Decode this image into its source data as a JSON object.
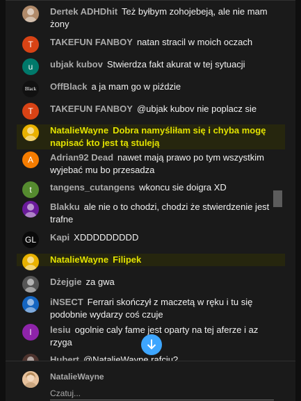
{
  "messages": [
    {
      "author": "Dertek ADHDhit",
      "text": "Też byłbym zohojebeją, ale nie mam żony",
      "avatar": {
        "letter": "",
        "color": "#b08a6a",
        "icon": "photo-avatar"
      }
    },
    {
      "author": "TAKEFUN FANBOY",
      "text": "natan stracil w moich oczach",
      "avatar": {
        "letter": "T",
        "color": "#d84315"
      }
    },
    {
      "author": "ubjak kubov",
      "text": "Stwierdza fakt akurat w tej sytuacji",
      "avatar": {
        "letter": "u",
        "color": "#00796b"
      }
    },
    {
      "author": "OffBlack",
      "text": "a ja mam go w piździe",
      "avatar": {
        "letter": "Black",
        "color": "#111111",
        "icon": "logo-avatar"
      }
    },
    {
      "author": "TAKEFUN FANBOY",
      "text": "@ubjak kubov nie poplacz sie",
      "avatar": {
        "letter": "T",
        "color": "#d84315"
      }
    },
    {
      "author": "NatalieWayne",
      "text": "Dobra namyśliłam się i chyba mogę napisać kto jest tą stuleją",
      "highlighted": true,
      "avatar": {
        "letter": "",
        "color": "#e8b100",
        "icon": "photo-avatar"
      }
    },
    {
      "author": "Adrian92 Dead",
      "text": "nawet mają prawo po tym wszystkim wyjebać mu bo przesadza",
      "avatar": {
        "letter": "A",
        "color": "#f57c00"
      }
    },
    {
      "author": "tangens_cutangens",
      "text": "wkoncu sie doigra XD",
      "avatar": {
        "letter": "t",
        "color": "#558b2f"
      }
    },
    {
      "author": "Blakku",
      "text": "ale nie o to chodzi, chodzi że stwierdzenie jest trafne",
      "avatar": {
        "letter": "",
        "color": "#6a1b9a",
        "icon": "photo-avatar"
      }
    },
    {
      "author": "Kapi",
      "text": "XDDDDDDDDD",
      "avatar": {
        "letter": "GL",
        "color": "#0a0a0a",
        "icon": "logo-avatar"
      }
    },
    {
      "author": "NatalieWayne",
      "text": "Filipek",
      "highlighted": true,
      "avatar": {
        "letter": "",
        "color": "#e8b100",
        "icon": "photo-avatar"
      }
    },
    {
      "author": "Dżejgie",
      "text": "za gwa",
      "avatar": {
        "letter": "",
        "color": "#555555",
        "icon": "photo-avatar"
      }
    },
    {
      "author": "iNSECT",
      "text": "Ferrari skończył z maczetą w ręku i tu się podobnie wydarzy coś czuje",
      "avatar": {
        "letter": "",
        "color": "#1565c0",
        "icon": "photo-avatar"
      }
    },
    {
      "author": "lesiu",
      "text": "ogolnie caly fame jest oparty na tej aferze i az rzyga",
      "avatar": {
        "letter": "l",
        "color": "#8e24aa"
      }
    },
    {
      "author": "Hubert",
      "text": "@NatalieWayne rafciu?",
      "avatar": {
        "letter": "",
        "color": "#4e342e",
        "icon": "photo-avatar"
      }
    }
  ],
  "composer": {
    "author": "NatalieWayne",
    "placeholder": "Czatuj...",
    "avatar": {
      "icon": "photo-avatar"
    }
  },
  "scroll_down_icon": "arrow-down-icon",
  "colors": {
    "background": "#1a1a1a",
    "highlight_bg": "#26260e",
    "highlight_text": "#e2e200",
    "accent": "#3ea6ff"
  }
}
